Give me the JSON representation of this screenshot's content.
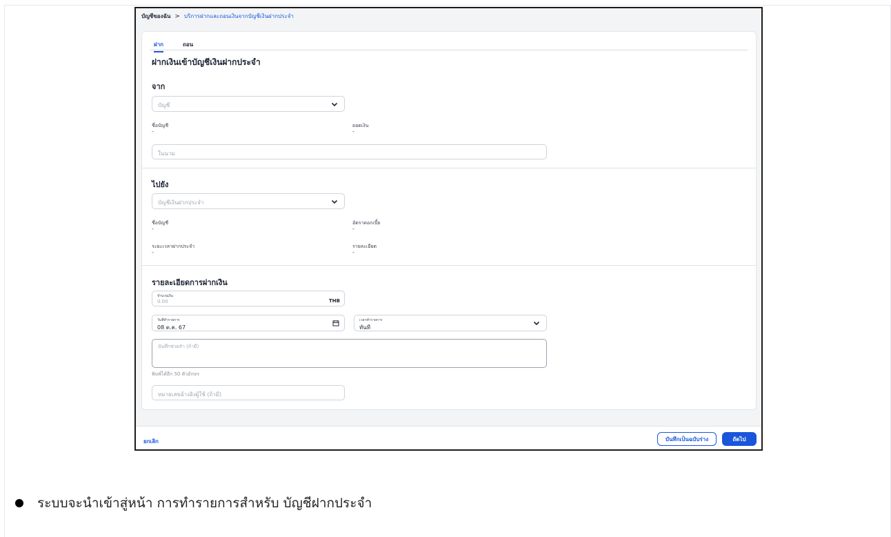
{
  "breadcrumb": {
    "home": "บัญชีของฉัน",
    "separator": ">",
    "current": "บริการฝากและถอนเงินจากบัญชีเงินฝากประจำ"
  },
  "tabs": [
    {
      "label": "ฝาก",
      "active": true
    },
    {
      "label": "ถอน",
      "active": false
    }
  ],
  "page_title": "ฝากเงินเข้าบัญชีเงินฝากประจำ",
  "from": {
    "section_label": "จาก",
    "account_select_placeholder": "บัญชี",
    "account_name_label": "ชื่อบัญชี",
    "account_name_value": "-",
    "balance_label": "ยอดเงิน",
    "balance_value": "-",
    "in_name_placeholder": "ในนาม"
  },
  "to": {
    "section_label": "ไปยัง",
    "account_select_placeholder": "บัญชีเงินฝากประจำ",
    "account_name_label": "ชื่อบัญชี",
    "account_name_value": "-",
    "interest_label": "อัตราดอกเบี้ย",
    "interest_value": "-",
    "term_label": "ระยะเวลาฝากประจำ",
    "term_value": "-",
    "details_label": "รายละเอียด",
    "details_value": "-"
  },
  "deposit": {
    "section_label": "รายละเอียดการฝากเงิน",
    "amount_label": "จำนวนเงิน",
    "amount_value": "0.00",
    "currency": "THB",
    "date_label": "วันที่ทำรายการ",
    "date_value": "08 ต.ค. 67",
    "time_label": "เวลาทำรายการ",
    "time_value": "ทันที",
    "memo_placeholder": "บันทึกช่วยจำ (ถ้ามี)",
    "memo_hint": "พิมพ์ได้อีก 50 ตัวอักษร",
    "reference_placeholder": "หมายเลขอ้างอิงผู้ใช้ (ถ้ามี)"
  },
  "footer": {
    "cancel_label": "ยกเลิก",
    "save_draft_label": "บันทึกเป็นฉบับร่าง",
    "next_label": "ถัดไป"
  },
  "caption": "ระบบจะนำเข้าสู่หน้า การทำรายการสำหรับ บัญชีฝากประจำ",
  "colors": {
    "accent": "#1a56db",
    "background": "#f3f4f6"
  },
  "icons": [
    "chevron-down-icon",
    "calendar-icon"
  ]
}
